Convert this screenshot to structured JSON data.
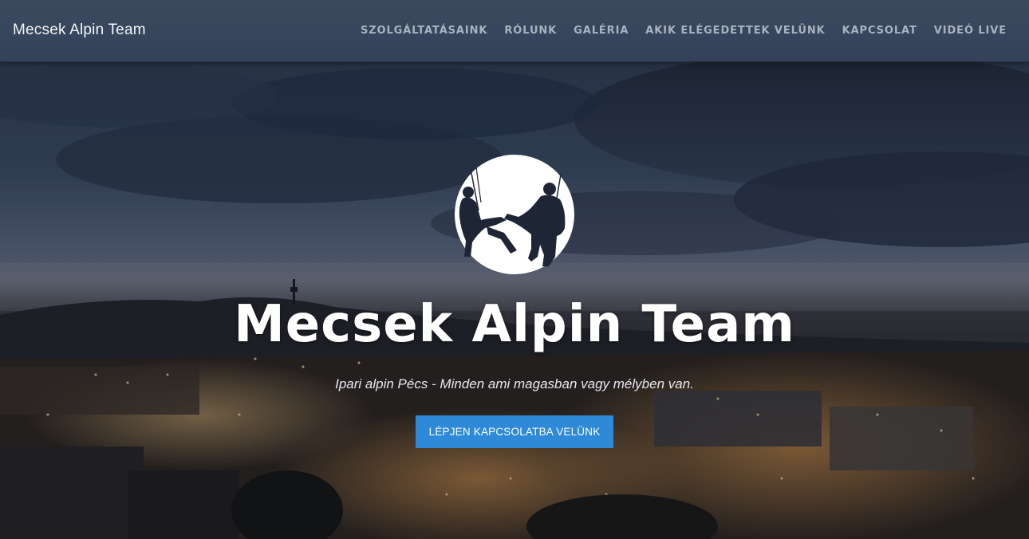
{
  "navbar": {
    "brand": "Mecsek Alpin Team",
    "items": [
      {
        "label": "SZOLGÁLTATÁSAINK"
      },
      {
        "label": "RÓLUNK"
      },
      {
        "label": "GALÉRIA"
      },
      {
        "label": "AKIK ELÉGEDETTEK VELÜNK"
      },
      {
        "label": "KAPCSOLAT"
      },
      {
        "label": "VIDEÓ LIVE"
      }
    ]
  },
  "hero": {
    "logo_icon": "rope-access-climbers-logo",
    "title": "Mecsek Alpin Team",
    "subtitle": "Ipari alpin Pécs - Minden ami magasban vagy mélyben van.",
    "cta_label": "LÉPJEN KAPCSOLATBA VELÜNK",
    "background": "night-city-panorama"
  },
  "colors": {
    "navbar_bg": "#37465c",
    "nav_text": "#a9b3c0",
    "cta_bg": "#2e8ad8",
    "title": "#ffffff"
  }
}
